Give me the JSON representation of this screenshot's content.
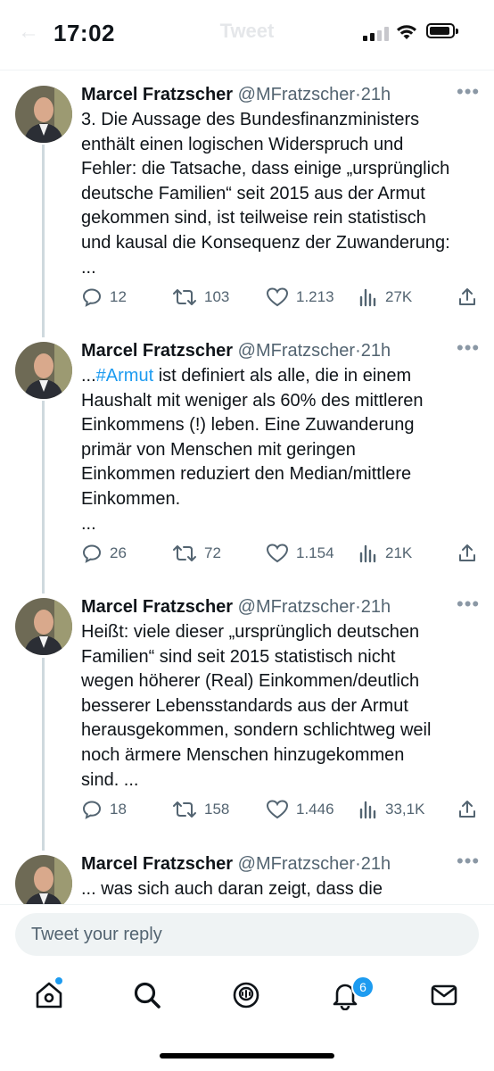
{
  "status": {
    "time": "17:02",
    "faded_title": "Tweet"
  },
  "tweets": [
    {
      "name": "Marcel Fratzscher",
      "handle": "@MFratzscher",
      "sep": "·",
      "age": "21h",
      "lines": [
        "3. Die Aussage des Bundesfinanzministers",
        "enthält einen logischen Widerspruch und",
        "Fehler: die Tatsache, dass einige „ursprünglich",
        "deutsche Familien“ seit 2015 aus der Armut",
        "gekommen sind, ist teilweise rein statistisch",
        "und kausal die Konsequenz der Zuwanderung:",
        "..."
      ],
      "replies": "12",
      "retweets": "103",
      "likes": "1.213",
      "views": "27K"
    },
    {
      "name": "Marcel Fratzscher",
      "handle": "@MFratzscher",
      "sep": "·",
      "age": "21h",
      "first_prefix": "...",
      "hashtag": "#Armut",
      "first_rest": " ist definiert als alle, die in einem",
      "lines": [
        "Haushalt mit weniger als 60% des mittleren",
        "Einkommens (!) leben. Eine Zuwanderung",
        "primär von Menschen mit geringen",
        "Einkommen reduziert den Median/mittlere",
        "Einkommen.",
        "..."
      ],
      "replies": "26",
      "retweets": "72",
      "likes": "1.154",
      "views": "21K"
    },
    {
      "name": "Marcel Fratzscher",
      "handle": "@MFratzscher",
      "sep": "·",
      "age": "21h",
      "lines": [
        "Heißt: viele dieser „ursprünglich deutschen",
        "Familien“ sind seit 2015 statistisch nicht",
        "wegen höherer (Real) Einkommen/deutlich",
        "besserer Lebensstandards aus der Armut",
        "herausgekommen, sondern schlichtweg weil",
        "noch ärmere Menschen hinzugekommen",
        "sind. ..."
      ],
      "replies": "18",
      "retweets": "158",
      "likes": "1.446",
      "views": "33,1K"
    },
    {
      "name": "Marcel Fratzscher",
      "handle": "@MFratzscher",
      "sep": "·",
      "age": "21h",
      "lines": [
        "... was sich auch daran zeigt, dass die"
      ]
    }
  ],
  "reply_placeholder": "Tweet your reply",
  "tabbar": {
    "items": [
      "home-icon",
      "search-icon",
      "spaces-icon",
      "notifications-icon",
      "messages-icon"
    ],
    "notification_count": "6",
    "accent": "#1d9bf0"
  }
}
